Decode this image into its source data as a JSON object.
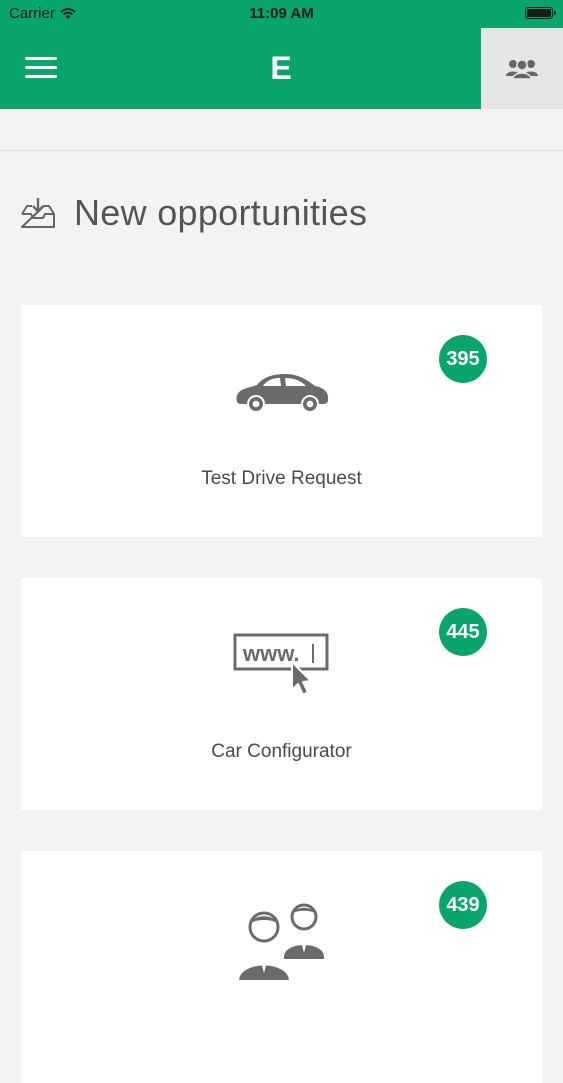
{
  "status_bar": {
    "carrier": "Carrier",
    "time": "11:09 AM"
  },
  "navbar": {
    "logo": "E",
    "menu_icon": "hamburger-icon",
    "contacts_icon": "people-icon"
  },
  "section": {
    "title": "New opportunities",
    "icon": "inbox-download-icon"
  },
  "cards": [
    {
      "label": "Test Drive Request",
      "count": "395",
      "icon": "car-icon"
    },
    {
      "label": "Car Configurator",
      "count": "445",
      "icon": "www-cursor-icon"
    },
    {
      "label": "",
      "count": "439",
      "icon": "people-icon"
    }
  ],
  "colors": {
    "brand": "#0aa56b",
    "background": "#f3f3f4",
    "card": "#ffffff",
    "icon_gray": "#6b6b6b"
  }
}
